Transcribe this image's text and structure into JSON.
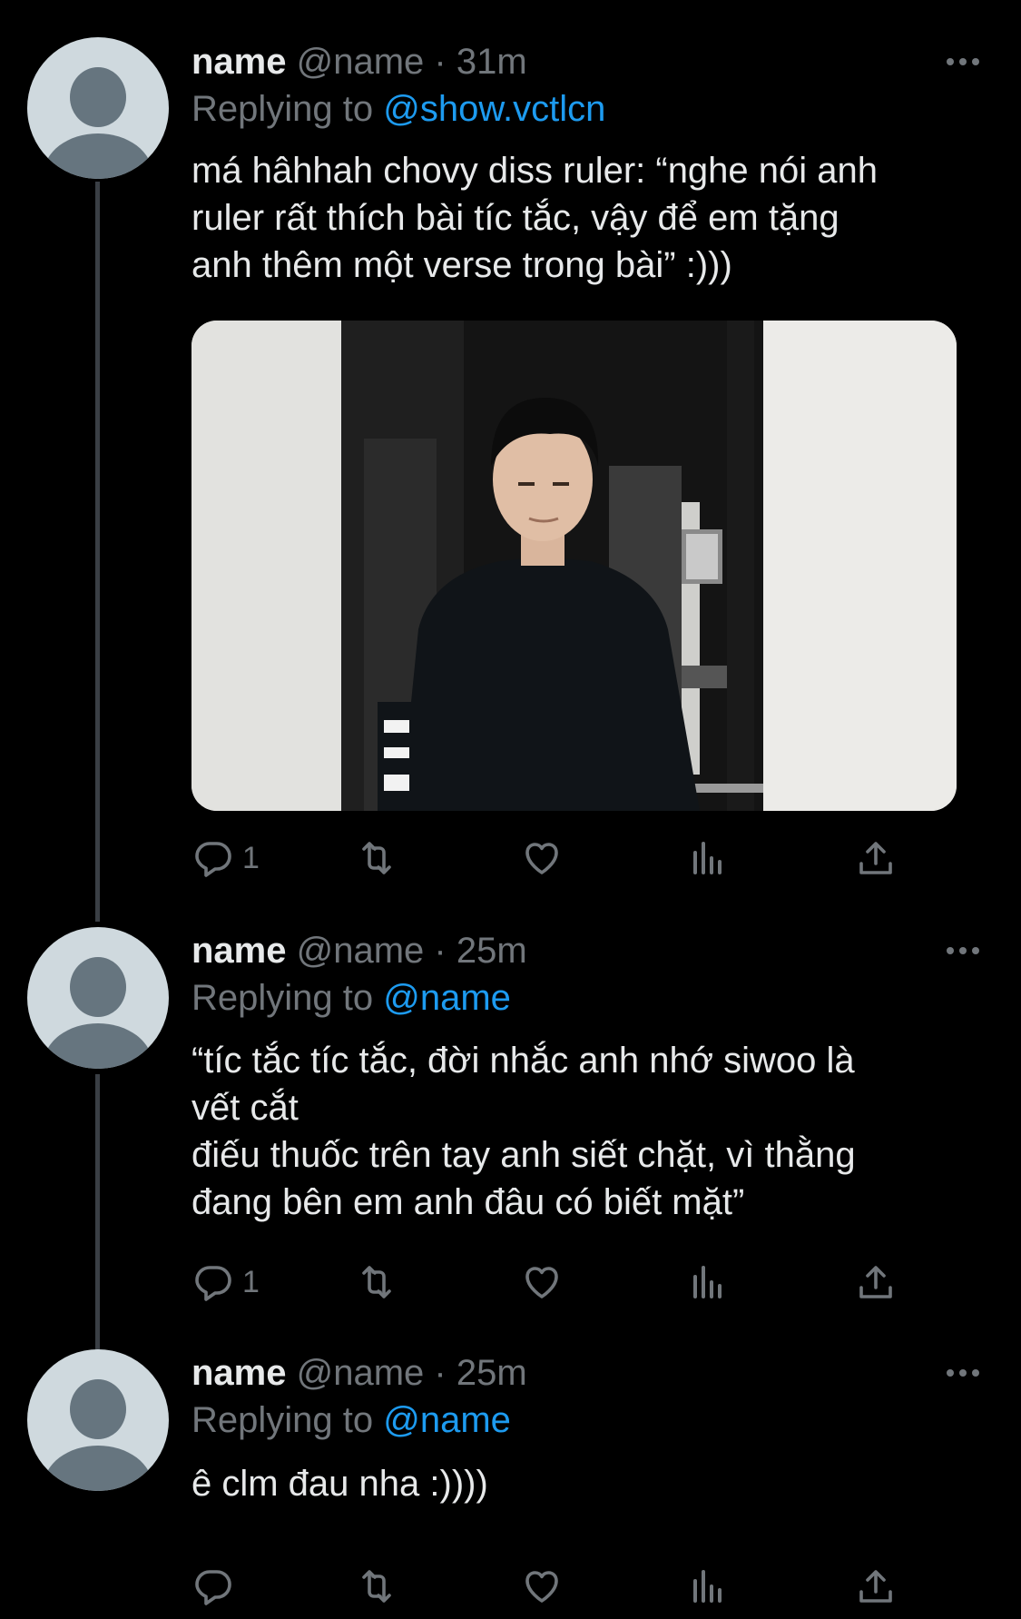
{
  "tweets": [
    {
      "name": "name",
      "handle": "@name",
      "time": "31m",
      "replying_prefix": "Replying to ",
      "replying_to": "@show.vctlcn",
      "text": "má hâhhah chovy diss ruler: “nghe nói anh\nruler rất thích bài tíc tắc, vậy để em tặng\nanh thêm một verse trong bài” :)))",
      "has_image": true,
      "reply_count": "1"
    },
    {
      "name": "name",
      "handle": "@name",
      "time": "25m",
      "replying_prefix": "Replying to ",
      "replying_to": "@name",
      "text": "“tíc tắc tíc tắc, đời nhắc anh nhớ siwoo là\nvết cắt\nđiếu thuốc trên tay anh siết chặt, vì thằng\nđang bên em anh đâu có biết mặt”",
      "has_image": false,
      "reply_count": "1"
    },
    {
      "name": "name",
      "handle": "@name",
      "time": "25m",
      "replying_prefix": "Replying to ",
      "replying_to": "@name",
      "text": "ê clm đau nha :))))",
      "has_image": false,
      "reply_count": ""
    }
  ],
  "separator": " · ",
  "colors": {
    "background": "#000000",
    "text": "#e7e9ea",
    "muted": "#71767b",
    "accent": "#1d9bf0"
  },
  "icons": [
    "more-icon",
    "reply-icon",
    "retweet-icon",
    "like-icon",
    "analytics-icon",
    "share-icon"
  ]
}
